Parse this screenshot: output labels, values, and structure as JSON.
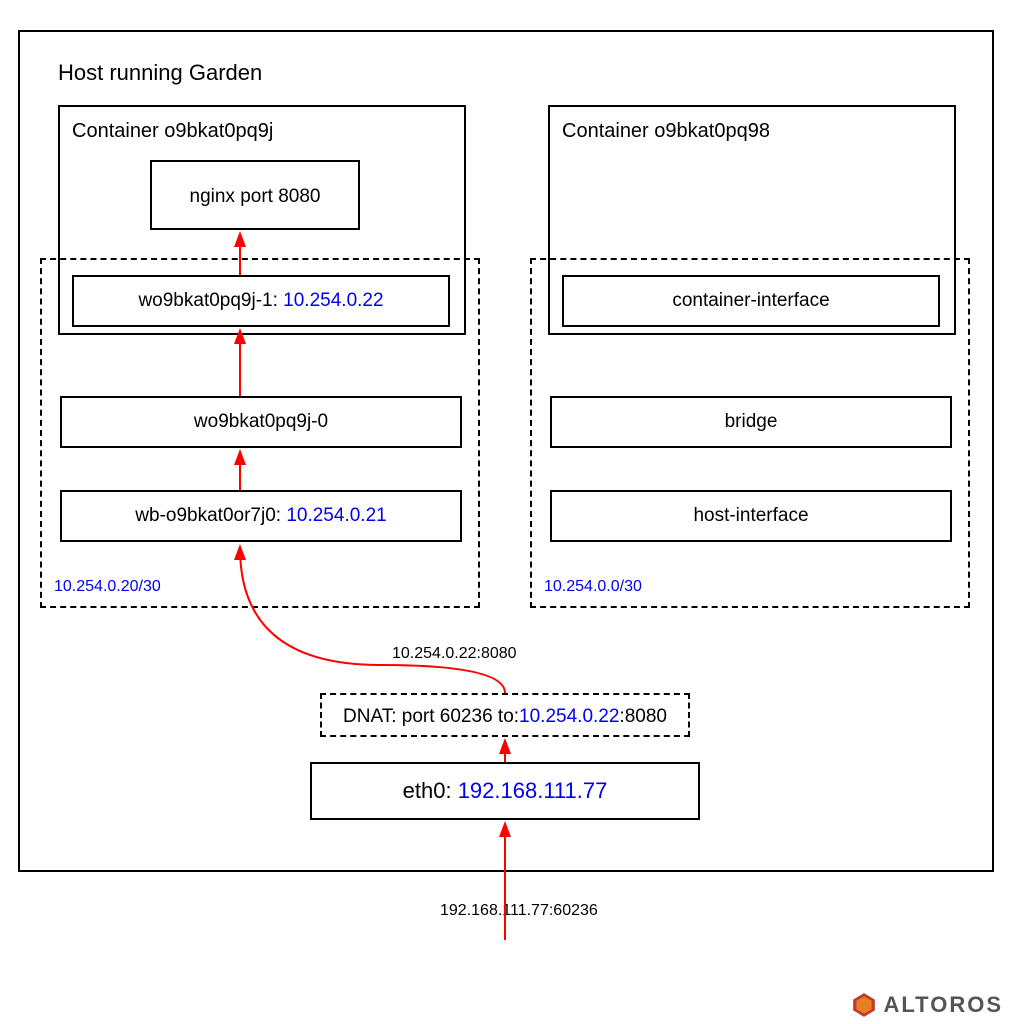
{
  "host": {
    "title": "Host running Garden"
  },
  "left": {
    "container_title": "Container o9bkat0pq9j",
    "service": "nginx port 8080",
    "iface_label": "wo9bkat0pq9j-1: ",
    "iface_ip": "10.254.0.22",
    "bridge": "wo9bkat0pq9j-0",
    "hostif_label": "wb-o9bkat0or7j0: ",
    "hostif_ip": "10.254.0.21",
    "subnet": "10.254.0.20/30"
  },
  "right": {
    "container_title": "Container o9bkat0pq98",
    "iface": "container-interface",
    "bridge": "bridge",
    "hostif": "host-interface",
    "subnet": "10.254.0.0/30"
  },
  "routing": {
    "upper_label": "10.254.0.22:8080",
    "dnat_pre": "DNAT: port 60236 to:",
    "dnat_ip": "10.254.0.22",
    "dnat_post": ":8080",
    "eth_label": "eth0: ",
    "eth_ip": "192.168.111.77",
    "entry": "192.168.111.77:60236"
  },
  "brand": "ALTOROS"
}
